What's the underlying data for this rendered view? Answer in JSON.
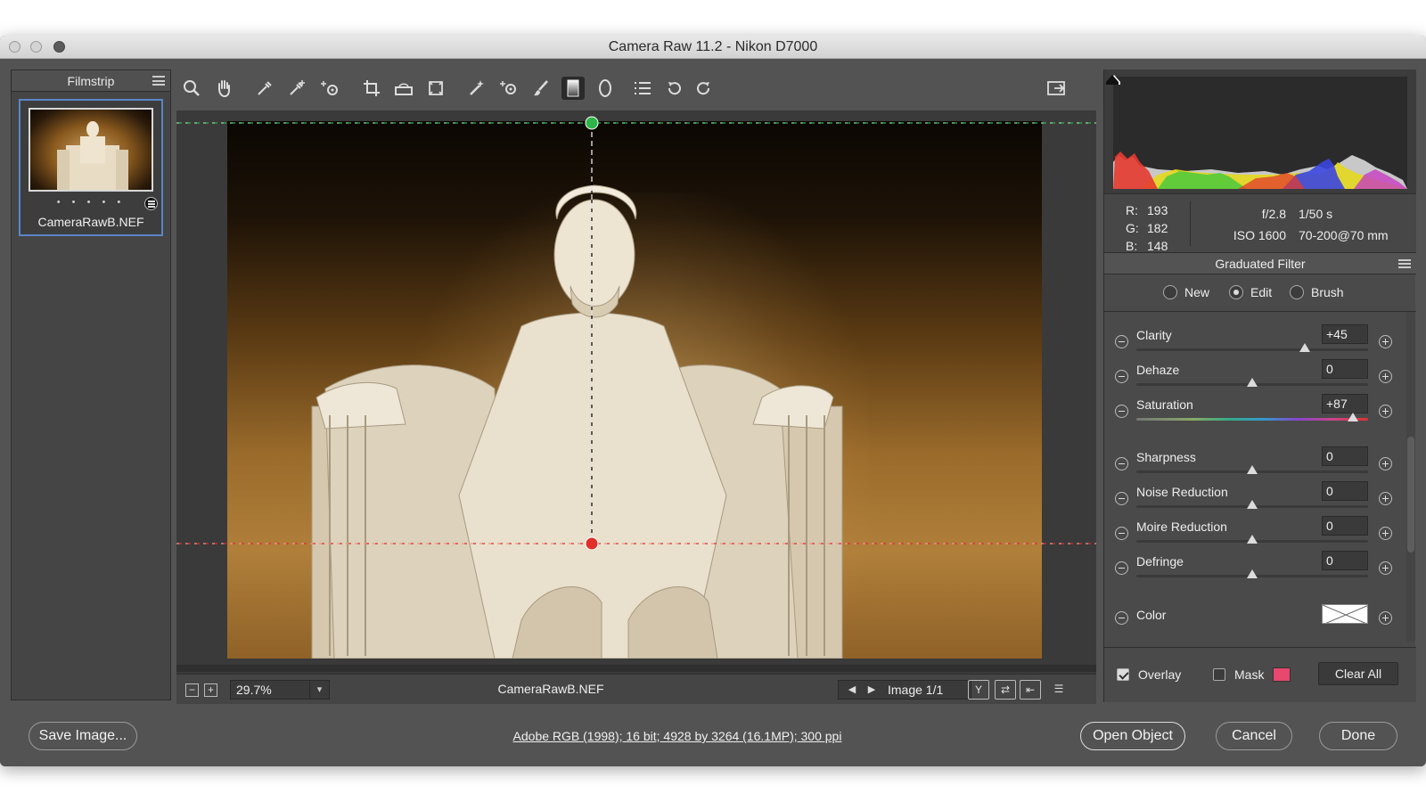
{
  "window": {
    "title": "Camera Raw 11.2  -  Nikon D7000"
  },
  "filmstrip": {
    "title": "Filmstrip",
    "item": {
      "name": "CameraRawB.NEF",
      "dots": "• • • • •"
    }
  },
  "toolbar": {
    "tools": [
      "zoom-icon",
      "hand-icon",
      "white-balance-icon",
      "color-sampler-icon",
      "targeted-adjustment-icon",
      "crop-icon",
      "straighten-icon",
      "transform-icon",
      "spot-removal-icon",
      "red-eye-icon",
      "adjustment-brush-icon",
      "graduated-filter-icon",
      "radial-filter-icon",
      "preferences-icon",
      "rotate-left-icon",
      "rotate-right-icon",
      "fullscreen-icon"
    ]
  },
  "statusbar": {
    "zoom_out": "−",
    "zoom_in": "+",
    "zoom": "29.7%",
    "filename": "CameraRawB.NEF",
    "image_counter": "Image 1/1",
    "prev": "◀",
    "next": "▶",
    "view_toggle": "Y",
    "swap": "⇄",
    "copy": "⇤",
    "settings": "☰"
  },
  "histogram": {
    "r": "193",
    "g": "182",
    "b": "148",
    "r_label": "R:",
    "g_label": "G:",
    "b_label": "B:",
    "aperture": "f/2.8",
    "shutter": "1/50 s",
    "iso": "ISO 1600",
    "lens": "70-200@70 mm"
  },
  "panel": {
    "title": "Graduated Filter",
    "modes": [
      {
        "label": "New",
        "selected": false
      },
      {
        "label": "Edit",
        "selected": true
      },
      {
        "label": "Brush",
        "selected": false
      }
    ],
    "sliders": [
      {
        "label": "Clarity",
        "value": "+45",
        "position": 0.725
      },
      {
        "label": "Dehaze",
        "value": "0",
        "position": 0.5
      },
      {
        "label": "Saturation",
        "value": "+87",
        "position": 0.935
      },
      {
        "label": "Sharpness",
        "value": "0",
        "position": 0.5
      },
      {
        "label": "Noise Reduction",
        "value": "0",
        "position": 0.5
      },
      {
        "label": "Moire Reduction",
        "value": "0",
        "position": 0.5
      },
      {
        "label": "Defringe",
        "value": "0",
        "position": 0.5
      }
    ],
    "color_label": "Color",
    "overlay": {
      "label": "Overlay",
      "checked": true
    },
    "mask": {
      "label": "Mask",
      "checked": false,
      "color": "#e8486e"
    },
    "clear_all": "Clear All"
  },
  "footer": {
    "save": "Save Image...",
    "info": "Adobe RGB (1998); 16 bit; 4928 by 3264 (16.1MP); 300 ppi",
    "open": "Open Object",
    "cancel": "Cancel",
    "done": "Done"
  },
  "colors": {
    "green_pin": "#2fb44a",
    "red_pin": "#e0302a"
  }
}
